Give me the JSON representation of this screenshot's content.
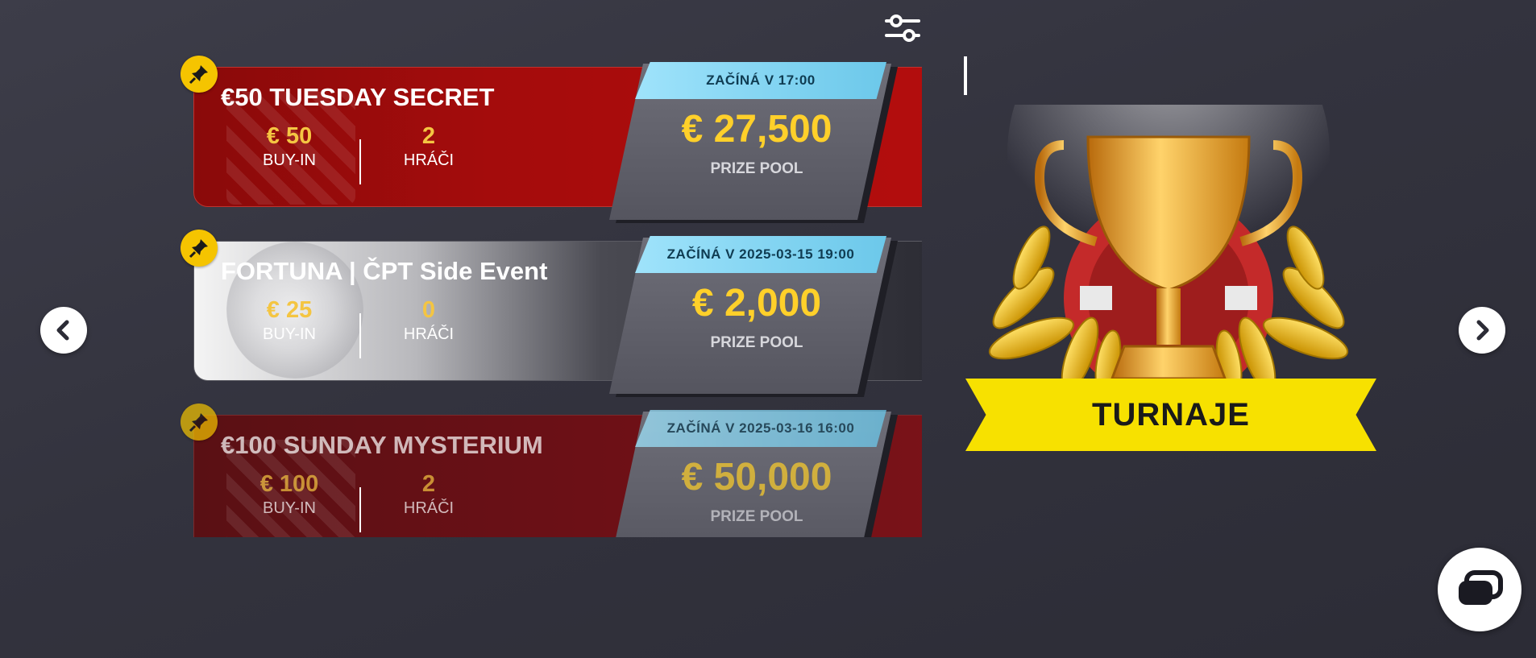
{
  "toolbar": {
    "filter_icon": "sliders-icon"
  },
  "navigation": {
    "prev_icon": "chevron-left-icon",
    "next_icon": "chevron-right-icon"
  },
  "tournaments": [
    {
      "name": "€50 TUESDAY SECRET",
      "buyin": "€ 50",
      "buyin_label": "BUY-IN",
      "players": "2",
      "players_label": "HRÁČI",
      "start": "ZAČÍNÁ V 17:00",
      "prize_pool": "€ 27,500",
      "prize_label": "PRIZE POOL",
      "style": "red"
    },
    {
      "name": "FORTUNA | ČPT Side Event",
      "buyin": "€ 25",
      "buyin_label": "BUY-IN",
      "players": "0",
      "players_label": "HRÁČI",
      "start": "ZAČÍNÁ V 2025-03-15 19:00",
      "prize_pool": "€ 2,000",
      "prize_label": "PRIZE POOL",
      "style": "grey"
    },
    {
      "name": "€100 SUNDAY MYSTERIUM",
      "buyin": "€ 100",
      "buyin_label": "BUY-IN",
      "players": "2",
      "players_label": "HRÁČI",
      "start": "ZAČÍNÁ V 2025-03-16 16:00",
      "prize_pool": "€ 50,000",
      "prize_label": "PRIZE POOL",
      "style": "red-faded"
    }
  ],
  "banner": {
    "label": "TURNAJE",
    "icon": "trophy-icon"
  },
  "chat": {
    "icon": "chat-icon"
  },
  "colors": {
    "accent_yellow": "#ffd02a",
    "start_blue": "#7fd3f0",
    "ribbon": "#f7e100",
    "card_red": "#a40c0c"
  }
}
